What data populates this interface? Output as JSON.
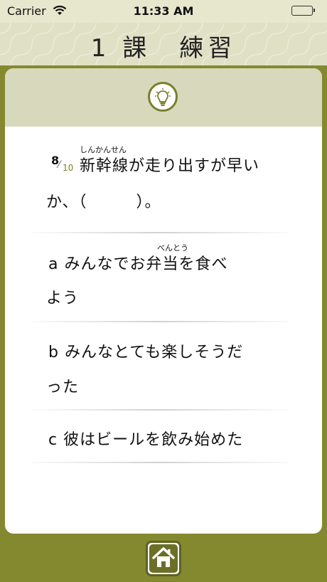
{
  "status_bar": {
    "carrier": "Carrier",
    "time": "11:33 AM"
  },
  "header": {
    "title": "1 課　練習"
  },
  "question": {
    "number": "8",
    "total": "10",
    "furigana_shinkansen": "しんかんせん",
    "line1": "新幹線が走り出すが早い",
    "line2": "か、（　　　）。"
  },
  "options": [
    {
      "letter": "a",
      "furigana": "べんとう",
      "line1": "みんなでお弁当を食べ",
      "line2": "よう"
    },
    {
      "letter": "b",
      "line1": "みんなとても楽しそうだ",
      "line2": "った"
    },
    {
      "letter": "c",
      "line1": "彼はビールを飲み始めた"
    }
  ],
  "icons": {
    "hint": "lightbulb-icon",
    "home": "home-icon",
    "wifi": "wifi-icon",
    "battery": "battery-icon"
  },
  "colors": {
    "accent": "#7a7f2c",
    "background": "#84892f",
    "header": "#dfe0c4",
    "battery": "#3ab54a"
  }
}
